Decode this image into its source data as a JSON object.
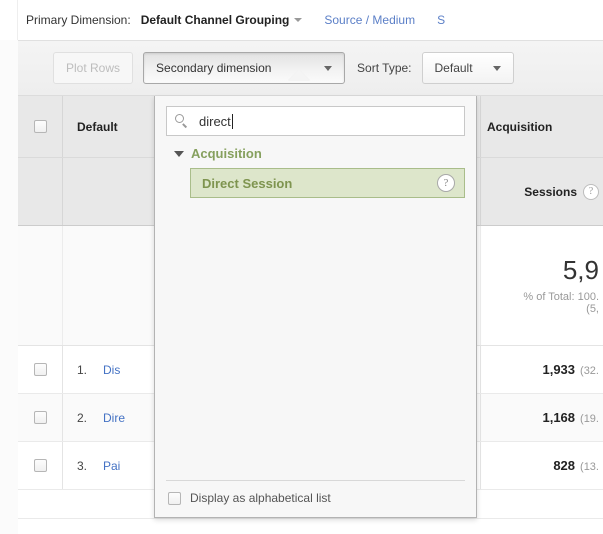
{
  "primary_bar": {
    "label": "Primary Dimension:",
    "selected": "Default Channel Grouping",
    "links": [
      {
        "text": "Source / Medium"
      },
      {
        "text": "S"
      }
    ]
  },
  "toolbar": {
    "plot_rows_label": "Plot Rows",
    "secondary_dimension_label": "Secondary dimension",
    "sort_type_label": "Sort Type:",
    "sort_type_value": "Default"
  },
  "dropdown": {
    "search": {
      "value": "direct",
      "placeholder": "",
      "icon": "search-icon"
    },
    "groups": [
      {
        "name": "Acquisition",
        "expanded": true,
        "options": [
          {
            "label": "Direct Session",
            "selected": true,
            "help_icon": "?"
          }
        ]
      }
    ],
    "footer": {
      "checkbox_label": "Display as alphabetical list",
      "checked": false
    }
  },
  "table": {
    "header": {
      "dimension_column": "Default",
      "metric_group": "Acquisition",
      "metric_name": "Sessions",
      "metric_help": "?"
    },
    "summary": {
      "value": "5,9",
      "pct_of_total": "% of Total: 100.",
      "absolute": "(5,"
    },
    "rows": [
      {
        "index": "1.",
        "dimension": "Dis",
        "value": "1,933",
        "pct": "(32."
      },
      {
        "index": "2.",
        "dimension": "Dire",
        "value": "1,168",
        "pct": "(19."
      },
      {
        "index": "3.",
        "dimension": "Pai",
        "value": "828",
        "pct": "(13."
      }
    ]
  },
  "colors": {
    "link_blue": "#4472c4",
    "dimension_link_blue": "#5b7fc7",
    "selected_green_bg": "#dde6cb",
    "selected_green_text": "#7e944f",
    "group_green": "#86a05e"
  }
}
